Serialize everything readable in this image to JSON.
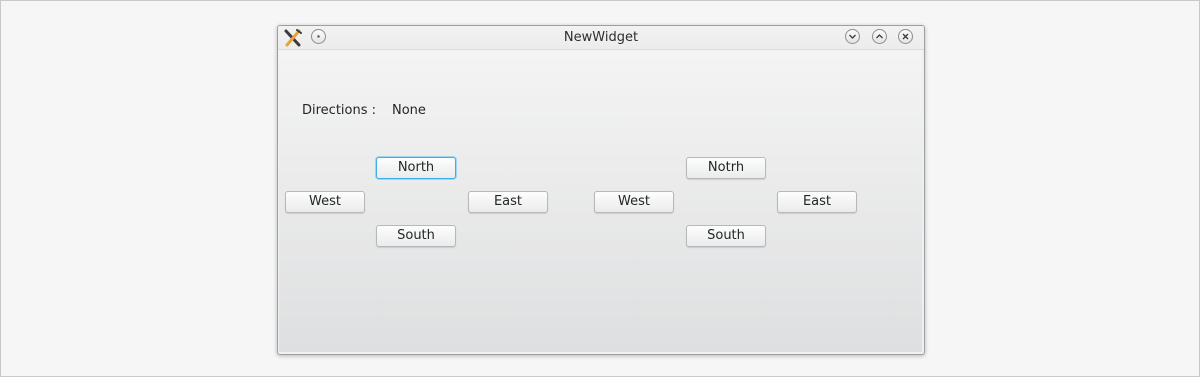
{
  "window": {
    "title": "NewWidget",
    "buttons": {
      "menu_icon": "dot-menu-icon",
      "minimize_icon": "chevron-down-icon",
      "maximize_icon": "chevron-up-icon",
      "close_icon": "close-icon"
    }
  },
  "directions": {
    "label": "Directions :",
    "value": "None"
  },
  "pad_left": {
    "north": "North",
    "west": "West",
    "east": "East",
    "south": "South"
  },
  "pad_right": {
    "north": "Notrh",
    "west": "West",
    "east": "East",
    "south": "South"
  },
  "colors": {
    "focus": "#3daee9",
    "background": "#eff0f1"
  }
}
